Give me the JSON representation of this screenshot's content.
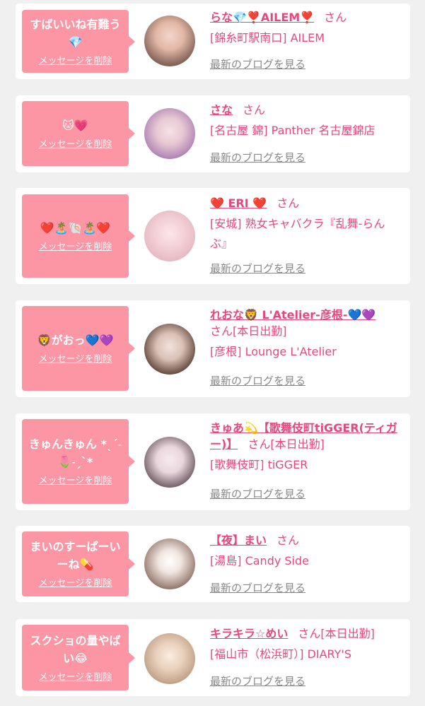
{
  "labels": {
    "delete": "メッセージを削除",
    "blog": "最新のブログを見る",
    "san": "さん"
  },
  "items": [
    {
      "message": "すばいいね有難う💎",
      "name": "らな💎❣️AILEM❣️",
      "status": "",
      "shop": "[錦糸町駅南口] AILEM"
    },
    {
      "message": "🐱💗",
      "name": "さな",
      "status": "",
      "shop": "[名古屋 錦] Panther 名古屋錦店"
    },
    {
      "message": "❤️🏝️🐚🏝️❤️",
      "name": "❤️ ERI ❤️",
      "status": "",
      "shop": "[安城] 熟女キャバクラ『乱舞-らんぶ』"
    },
    {
      "message": "🦁がおっ💙💜",
      "name": "れおな🦁 L'Atelier-彦根-💙💜",
      "status": "[本日出勤]",
      "shop": "[彦根] Lounge L'Atelier"
    },
    {
      "message": "きゅんきゅん *ˎˊ˗🌷˗ˏˋ*",
      "name": "きゅあ💫【歌舞伎町tiGGER(ティガー)】",
      "status": "[本日出勤]",
      "shop": "[歌舞伎町] tiGGER"
    },
    {
      "message": "まいのすーぱーいーね💊",
      "name": "【夜】まい",
      "status": "",
      "shop": "[湯島] Candy Side"
    },
    {
      "message": "スクショの量やばい😂",
      "name": "キラキラ☆めい",
      "status": "[本日出勤]",
      "shop": "[福山市（松浜町）] DIARY'S"
    }
  ],
  "colors": {
    "accent": "#e9467c",
    "bubble": "#fc95a4",
    "link_gray": "#888888",
    "background": "#f0f0f0"
  }
}
